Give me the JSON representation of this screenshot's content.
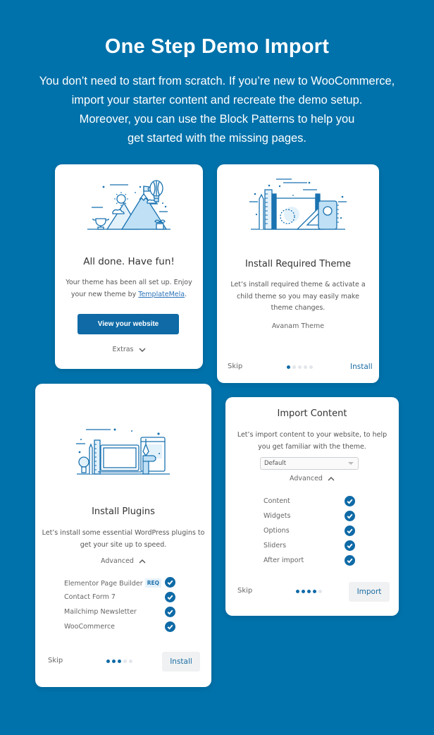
{
  "hero": {
    "title": "One Step Demo Import",
    "lines": [
      "You don’t need to start from scratch. If you’re new to WooCommerce,",
      "import your starter content and recreate the demo setup.",
      "Moreover, you can use the Block Patterns to help you",
      "get started with the missing pages."
    ]
  },
  "colors": {
    "background": "#0072ab",
    "accent": "#0f6aa6",
    "card": "#ffffff"
  },
  "done_card": {
    "illustration": "mountain-balloon-illustration",
    "title": "All done. Have fun!",
    "desc_prefix": "Your theme has been all set up. Enjoy your new theme by ",
    "link_text": "TemplateMela",
    "desc_suffix": ".",
    "button_label": "View your website",
    "extras_label": "Extras"
  },
  "theme_card": {
    "illustration": "drafting-tools-illustration",
    "title": "Install Required Theme",
    "desc": "Let’s install required theme & activate a child theme so you may easily make theme changes.",
    "theme_name": "Avanam Theme",
    "skip_label": "Skip",
    "action_label": "Install",
    "step": {
      "current": 1,
      "total": 5
    }
  },
  "plugins_card": {
    "illustration": "laptop-workspace-illustration",
    "title": "Install Plugins",
    "desc": "Let’s install some essential WordPress plugins to get your site up to speed.",
    "advanced_label": "Advanced",
    "plugins": [
      {
        "name": "Elementor Page Builder",
        "badge": "REQ",
        "checked": true
      },
      {
        "name": "Contact Form 7",
        "badge": "",
        "checked": true
      },
      {
        "name": "Mailchimp Newsletter",
        "badge": "",
        "checked": true
      },
      {
        "name": "WooCommerce",
        "badge": "",
        "checked": true
      }
    ],
    "skip_label": "Skip",
    "action_label": "Install",
    "step": {
      "current": 3,
      "total": 5
    }
  },
  "import_card": {
    "title": "Import Content",
    "desc": "Let’s import content to your website, to help you get familiar with the theme.",
    "select_value": "Default",
    "advanced_label": "Advanced",
    "items": [
      {
        "name": "Content",
        "checked": true
      },
      {
        "name": "Widgets",
        "checked": true
      },
      {
        "name": "Options",
        "checked": true
      },
      {
        "name": "Sliders",
        "checked": true
      },
      {
        "name": "After import",
        "checked": true
      }
    ],
    "skip_label": "Skip",
    "action_label": "Import",
    "step": {
      "current": 4,
      "total": 5
    }
  }
}
